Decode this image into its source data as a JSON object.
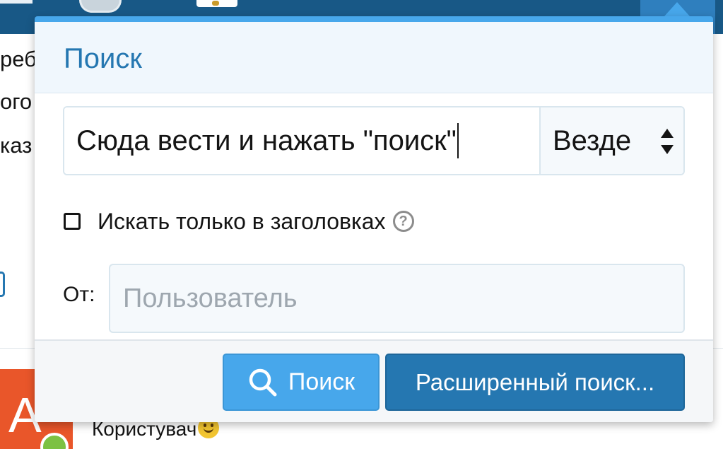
{
  "background_page": {
    "text_fragments": [
      "реб",
      "ого",
      "каз"
    ],
    "avatar_letter": "A",
    "username": "Користувач"
  },
  "search_menu": {
    "title": "Поиск",
    "query_value": "Сюда вести и нажать \"поиск\"",
    "scope_selected": "Везде",
    "titles_only_label": "Искать только в заголовках",
    "titles_only_checked": false,
    "help_glyph": "?",
    "from_label": "От:",
    "user_placeholder": "Пользователь",
    "search_button_label": "Поиск",
    "advanced_button_label": "Расширенный поиск..."
  },
  "colors": {
    "header_bar": "#185886",
    "accent": "#47a7eb",
    "primary_button": "#2577b1",
    "title_text": "#2577b1",
    "avatar_bg": "#e9562a",
    "online_dot": "#7cc142"
  },
  "icons": [
    "shield-icon",
    "search-icon",
    "help-icon",
    "select-arrows-icon",
    "smiley-icon"
  ]
}
